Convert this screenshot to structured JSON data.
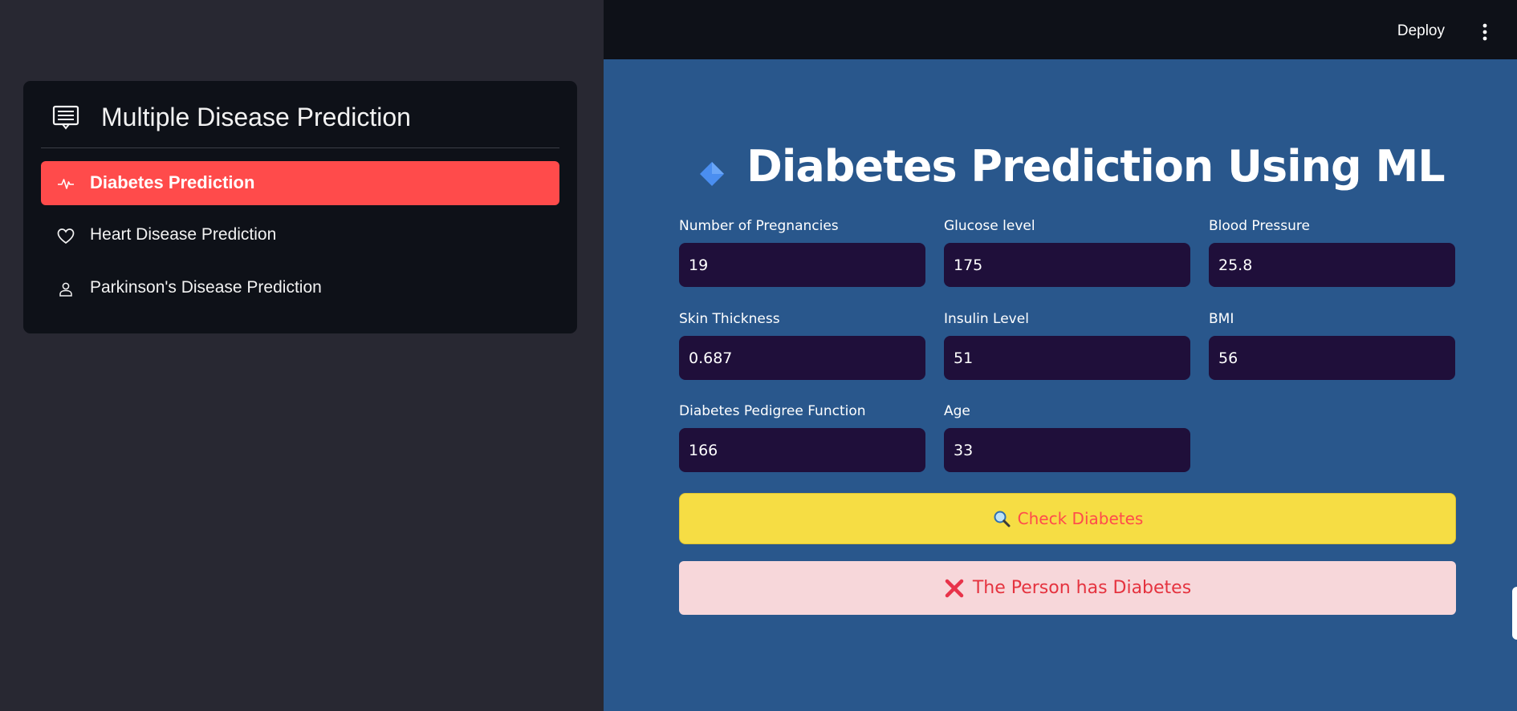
{
  "sidebar": {
    "menu_title": "Multiple Disease Prediction",
    "menu_title_icon": "list-icon",
    "items": [
      {
        "label": "Diabetes Prediction",
        "icon": "activity-icon",
        "active": true
      },
      {
        "label": "Heart Disease Prediction",
        "icon": "heart-icon",
        "active": false
      },
      {
        "label": "Parkinson's Disease Prediction",
        "icon": "person-icon",
        "active": false
      }
    ]
  },
  "header": {
    "deploy_label": "Deploy",
    "menu_icon": "kebab-menu-icon"
  },
  "main": {
    "title_icon": "diamond-icon",
    "title": "Diabetes Prediction Using ML",
    "fields": [
      {
        "label": "Number of Pregnancies",
        "value": "19"
      },
      {
        "label": "Glucose level",
        "value": "175"
      },
      {
        "label": "Blood Pressure",
        "value": "25.8"
      },
      {
        "label": "Skin Thickness",
        "value": "0.687"
      },
      {
        "label": "Insulin Level",
        "value": "51"
      },
      {
        "label": "BMI",
        "value": "56"
      },
      {
        "label": "Diabetes Pedigree Function",
        "value": "166"
      },
      {
        "label": "Age",
        "value": "33"
      }
    ],
    "check_button_label": "Check Diabetes",
    "check_button_icon": "magnifier-icon",
    "result_text": "The Person has Diabetes",
    "result_icon": "cross-icon"
  },
  "colors": {
    "sidebar_bg": "#282832",
    "card_bg": "#0e1118",
    "active_item": "#ff4b4b",
    "main_bg": "#29578c",
    "input_bg": "#1f0f3a",
    "button_bg": "#f6dd44",
    "alert_bg": "#f7d7da",
    "alert_text": "#e5333f"
  }
}
